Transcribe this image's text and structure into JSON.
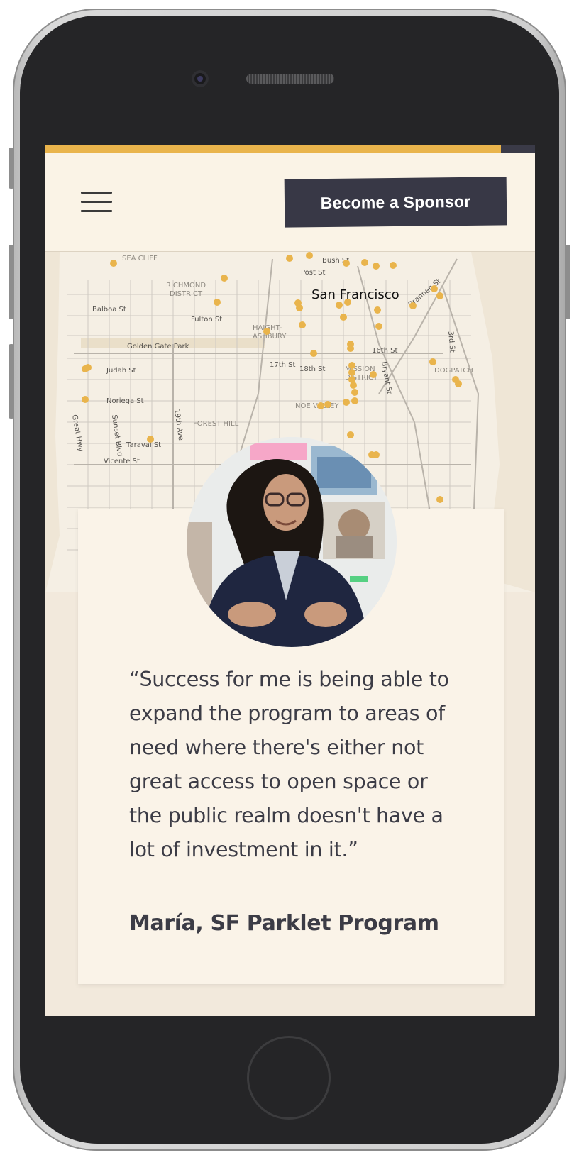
{
  "header": {
    "menu_icon": "hamburger-menu-icon",
    "sponsor_button_label": "Become a Sponsor"
  },
  "progress": {
    "fraction": 0.93,
    "fill_color": "#e9b44c",
    "track_color": "#3a3a47"
  },
  "map": {
    "city_label": "San Francisco",
    "dot_color": "#e9b44c",
    "district_labels": [
      "SEA CLIFF",
      "RICHMOND",
      "DISTRICT",
      "HAIGHT-",
      "ASHBURY",
      "FOREST HILL",
      "NOE VALLEY",
      "MISSION",
      "DISTRICT",
      "DOGPATCH"
    ],
    "street_labels": [
      "Balboa St",
      "Fulton St",
      "Golden Gate Park",
      "Judah St",
      "Noriega St",
      "Taraval St",
      "Vicente St",
      "Great Hwy",
      "Sunset Blvd",
      "19th Ave",
      "Bush St",
      "Post St",
      "17th St",
      "18th St",
      "16th St",
      "Bryant St",
      "3rd St",
      "Brannan St"
    ]
  },
  "testimonial": {
    "quote": "“Success for me is being able to expand the program to areas of need where there's either not great access to open space or the public realm doesn't have a lot of investment in it.”",
    "attribution": "María, SF Parklet Program"
  },
  "colors": {
    "accent": "#e9b44c",
    "button_bg": "#383846",
    "text": "#3c3c46",
    "card_bg": "#faf3e8",
    "page_bg": "#f2e9dc"
  }
}
